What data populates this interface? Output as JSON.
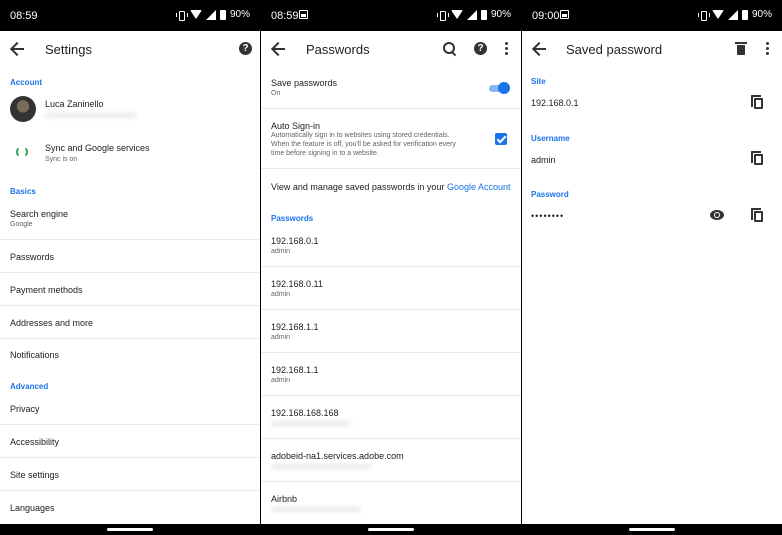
{
  "screen1": {
    "status": {
      "time": "08:59",
      "battery": "90%"
    },
    "title": "Settings",
    "sections": {
      "account": "Account",
      "basics": "Basics",
      "advanced": "Advanced"
    },
    "account": {
      "name": "Luca Zaninello"
    },
    "sync": {
      "title": "Sync and Google services",
      "subtitle": "Sync is on"
    },
    "search_engine": {
      "title": "Search engine",
      "subtitle": "Google"
    },
    "items": {
      "passwords": "Passwords",
      "payment_methods": "Payment methods",
      "addresses": "Addresses and more",
      "notifications": "Notifications",
      "privacy": "Privacy",
      "accessibility": "Accessibility",
      "site_settings": "Site settings",
      "languages": "Languages"
    }
  },
  "screen2": {
    "status": {
      "time": "08:59",
      "battery": "90%"
    },
    "title": "Passwords",
    "save_passwords": {
      "title": "Save passwords",
      "subtitle": "On",
      "enabled": true
    },
    "auto_signin": {
      "title": "Auto Sign-in",
      "line1": "Automatically sign in to websites using stored credentials.",
      "line2": "When the feature is off, you'll be asked for verification every",
      "line3": "time before signing in to a website.",
      "checked": true
    },
    "manage": {
      "text": "View and manage saved passwords in your ",
      "link": "Google Account"
    },
    "section_label": "Passwords",
    "entries": [
      {
        "site": "192.168.0.1",
        "user": "admin"
      },
      {
        "site": "192.168.0.11",
        "user": "admin"
      },
      {
        "site": "192.168.1.1",
        "user": "admin"
      },
      {
        "site": "192.168.1.1",
        "user": "admin"
      },
      {
        "site": "192.168.168.168",
        "user": ""
      },
      {
        "site": "adobeid-na1.services.adobe.com",
        "user": ""
      },
      {
        "site": "Airbnb",
        "user": ""
      }
    ]
  },
  "screen3": {
    "status": {
      "time": "09:00",
      "battery": "90%"
    },
    "title": "Saved password",
    "site_label": "Site",
    "site_value": "192.168.0.1",
    "username_label": "Username",
    "username_value": "admin",
    "password_label": "Password",
    "password_value": "••••••••"
  }
}
